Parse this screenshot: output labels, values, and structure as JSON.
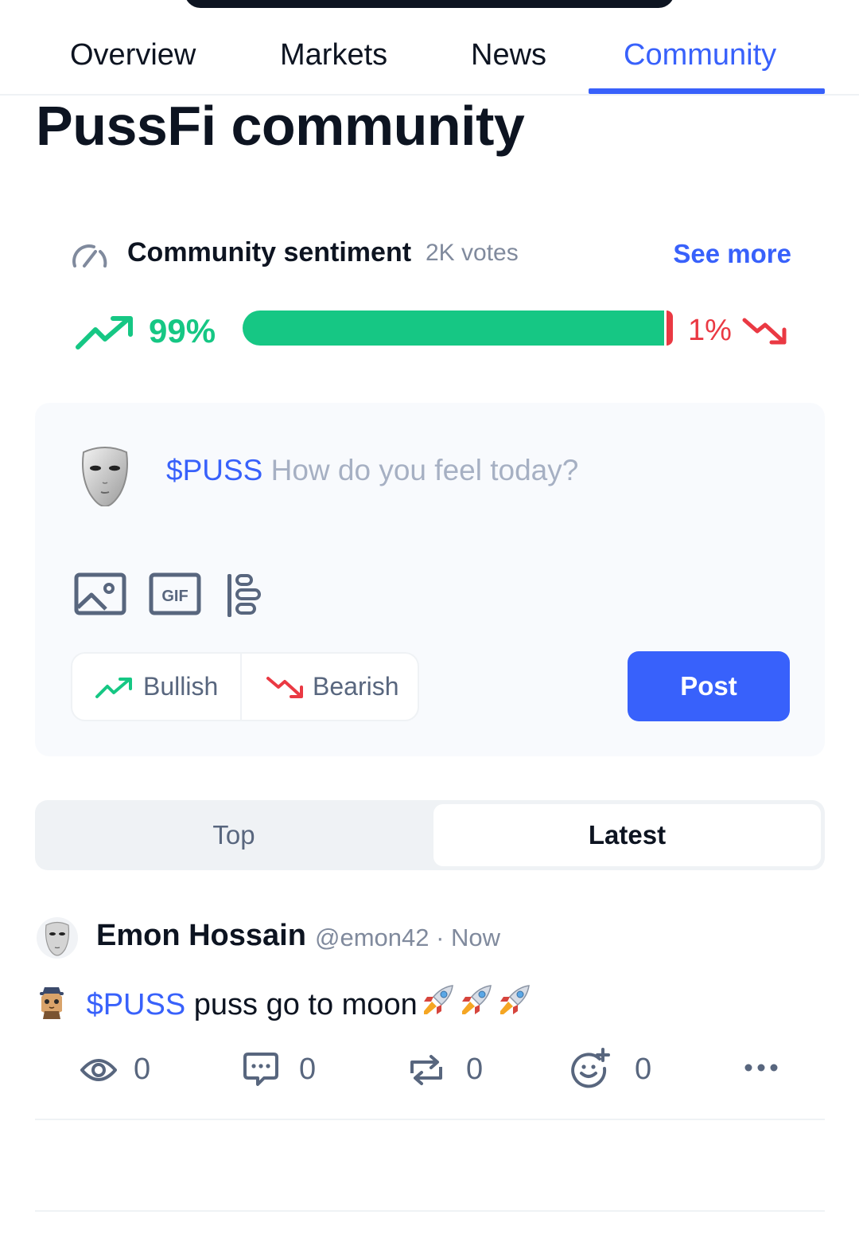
{
  "tabs": [
    {
      "label": "Overview"
    },
    {
      "label": "Markets"
    },
    {
      "label": "News"
    },
    {
      "label": "Community"
    }
  ],
  "active_tab": "Community",
  "page_title": "PussFi community",
  "sentiment": {
    "title": "Community sentiment",
    "votes": "2K votes",
    "see_more": "See more",
    "bullish_pct": "99%",
    "bearish_pct": "1%",
    "bullish_fraction": 0.99,
    "bearish_fraction": 0.01
  },
  "composer": {
    "ticker": "$PUSS",
    "placeholder": "How do you feel today?",
    "tools": [
      "image-icon",
      "gif-icon",
      "poll-icon"
    ],
    "bullish_label": "Bullish",
    "bearish_label": "Bearish",
    "post_label": "Post"
  },
  "feed_tabs": {
    "top": "Top",
    "latest": "Latest",
    "active": "Latest"
  },
  "posts": [
    {
      "author": "Emon Hossain",
      "handle_time": "@emon42 · Now",
      "ticker": "$PUSS",
      "text": "puss go to moon",
      "views": "0",
      "comments": "0",
      "reposts": "0",
      "reactions": "0"
    }
  ],
  "colors": {
    "accent": "#3861fb",
    "bullish": "#16c784",
    "bearish": "#ea3943",
    "text": "#0d1421",
    "muted": "#808a9d"
  }
}
